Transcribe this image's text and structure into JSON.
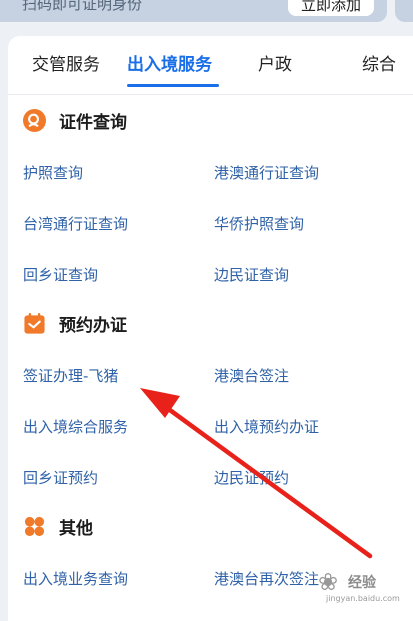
{
  "top_banner": {
    "hint_text": "扫码即可证明身份",
    "add_button_label": "立即添加"
  },
  "tabs": [
    {
      "label": "交管服务",
      "active": false
    },
    {
      "label": "出入境服务",
      "active": true
    },
    {
      "label": "户政",
      "active": false
    },
    {
      "label": "综合",
      "active": false
    }
  ],
  "sections": [
    {
      "title": "证件查询",
      "icon": "search-icon",
      "icon_color": "#f07a2a",
      "items": [
        "护照查询",
        "港澳通行证查询",
        "台湾通行证查询",
        "华侨护照查询",
        "回乡证查询",
        "边民证查询"
      ]
    },
    {
      "title": "预约办证",
      "icon": "calendar-icon",
      "icon_color": "#f07a2a",
      "items": [
        "签证办理-飞猪",
        "港澳台签注",
        "出入境综合服务",
        "出入境预约办证",
        "回乡证预约",
        "边民证预约"
      ]
    },
    {
      "title": "其他",
      "icon": "grid-icon",
      "icon_color": "#f07a2a",
      "items": [
        "出入境业务查询",
        "港澳台再次签注"
      ]
    }
  ],
  "watermark": {
    "text": "经验",
    "url": "jingyan.baidu.com"
  },
  "colors": {
    "accent": "#1a6fe8",
    "link": "#2f62a8",
    "section_icon": "#f07a2a",
    "annotation_arrow": "#e8221b"
  }
}
